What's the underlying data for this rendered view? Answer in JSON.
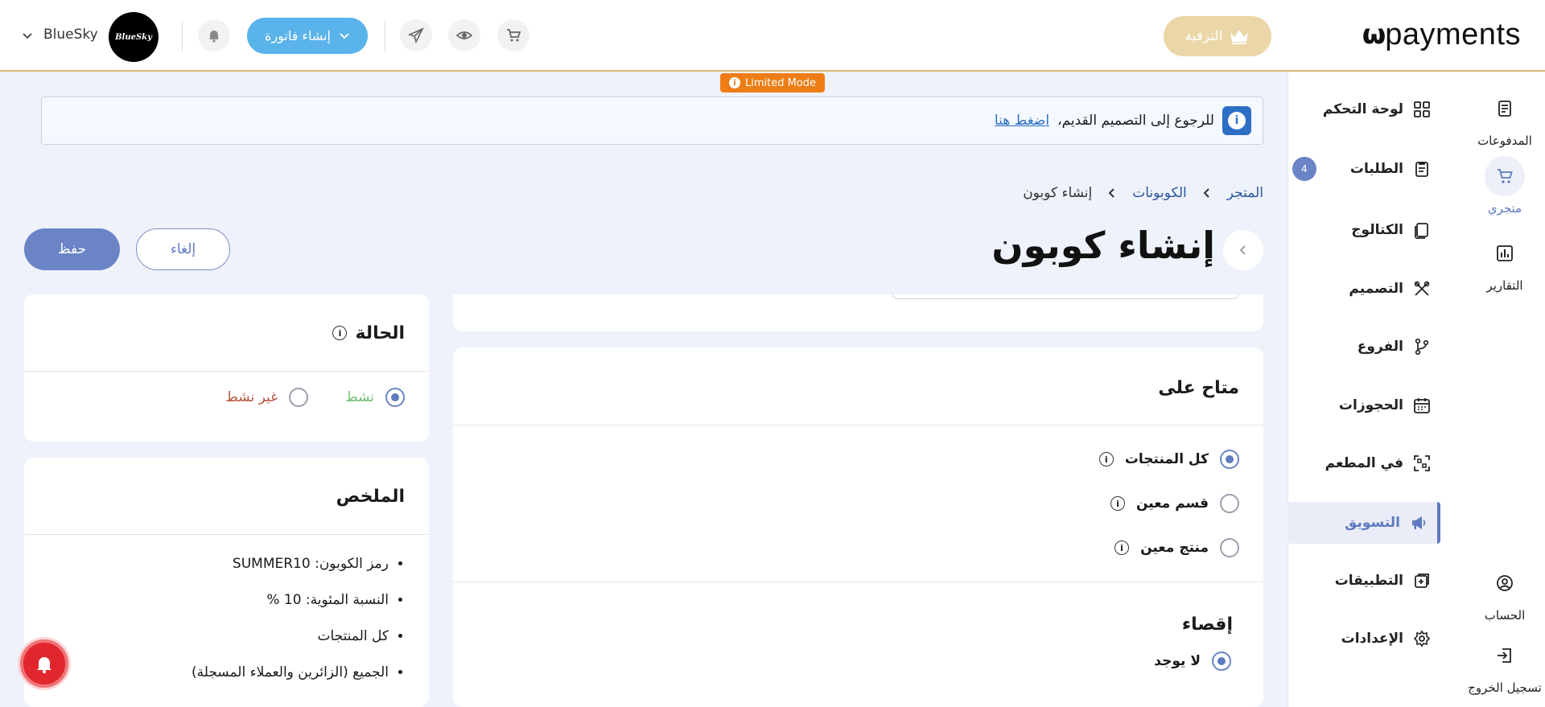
{
  "topbar": {
    "logo_text": "payments",
    "upgrade_label": "الترقية",
    "invoice_label": "إنشاء فاتورة",
    "brand_name": "BlueSky",
    "brand_avatar_text": "BlueSky"
  },
  "rail": {
    "items": [
      {
        "label": "المدفوعات",
        "icon": "wallet-icon"
      },
      {
        "label": "متجري",
        "icon": "cart-icon"
      },
      {
        "label": "التقارير",
        "icon": "chart-icon"
      },
      {
        "label": "الحساب",
        "icon": "account-icon"
      },
      {
        "label": "تسجيل الخروج",
        "icon": "logout-icon"
      }
    ]
  },
  "menu": {
    "items": [
      {
        "label": "لوحة التحكم",
        "icon": "grid-icon"
      },
      {
        "label": "الطلبات",
        "icon": "clipboard-icon",
        "badge": "4"
      },
      {
        "label": "الكتالوج",
        "icon": "book-icon"
      },
      {
        "label": "التصميم",
        "icon": "tools-icon"
      },
      {
        "label": "الفروع",
        "icon": "branch-icon"
      },
      {
        "label": "الحجوزات",
        "icon": "calendar-icon"
      },
      {
        "label": "في المطعم",
        "icon": "qr-icon"
      },
      {
        "label": "التسويق",
        "icon": "megaphone-icon"
      },
      {
        "label": "التطبيقات",
        "icon": "apps-icon"
      },
      {
        "label": "الإعدادات",
        "icon": "gear-icon"
      }
    ],
    "active": "التسويق"
  },
  "limited_mode": "Limited Mode",
  "banner": {
    "text": "للرجوع إلى التصميم القديم،",
    "link": "اضغط هنا"
  },
  "breadcrumb": {
    "items": [
      "المتجر",
      "الكوبونات",
      "إنشاء كوبون"
    ]
  },
  "page": {
    "title": "إنشاء كوبون",
    "cancel_label": "إلغاء",
    "save_label": "حفظ"
  },
  "availability": {
    "title": "متاح على",
    "options": [
      "كل المنتجات",
      "قسم معين",
      "منتج معين"
    ],
    "selected": "كل المنتجات"
  },
  "exclusion": {
    "title": "إقصاء",
    "option": "لا يوجد"
  },
  "status": {
    "title": "الحالة",
    "active_label": "نشط",
    "inactive_label": "غير نشط",
    "selected": "نشط",
    "active_color": "#6fbf73",
    "inactive_color": "#b5533c"
  },
  "summary": {
    "title": "الملخص",
    "items": [
      "رمز الكوبون: SUMMER10",
      "النسبة المئوية: 10 %",
      "كل المنتجات",
      "الجميع (الزائرين والعملاء المسجلة)"
    ]
  },
  "colors": {
    "accent": "#6b84c6",
    "upgrade": "#ead6a6",
    "invoice": "#5ab3ea",
    "limited": "#ee7d15",
    "notif": "#e1272e"
  }
}
